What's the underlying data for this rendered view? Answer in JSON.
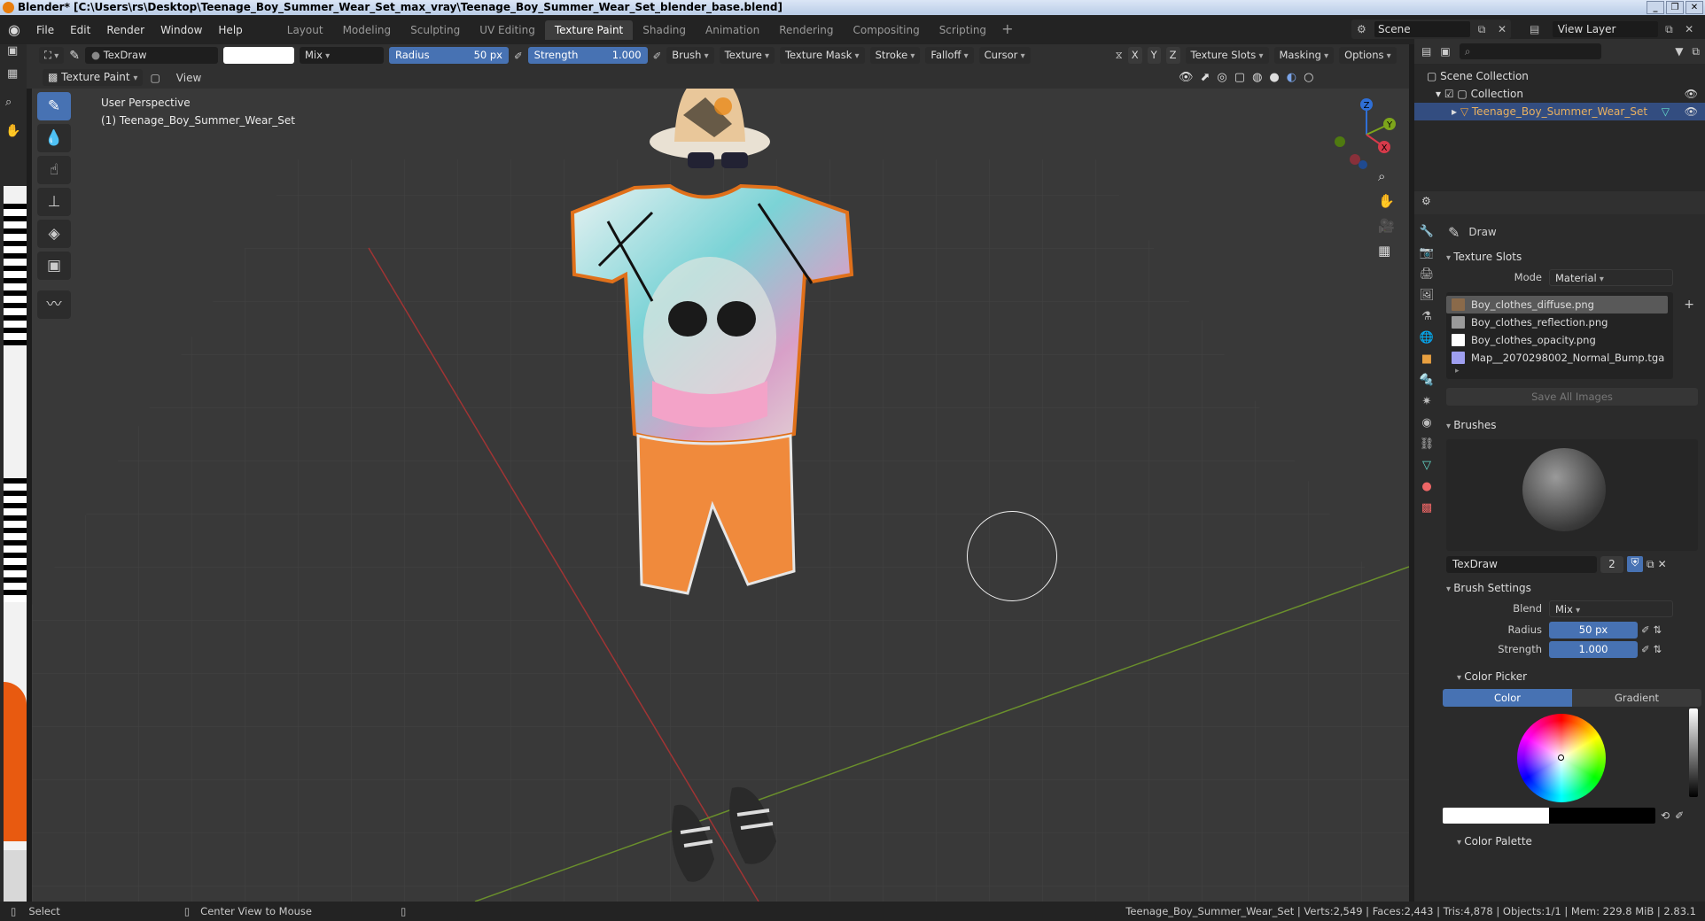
{
  "window": {
    "title": "Blender* [C:\\Users\\rs\\Desktop\\Teenage_Boy_Summer_Wear_Set_max_vray\\Teenage_Boy_Summer_Wear_Set_blender_base.blend]",
    "controls": [
      "_",
      "❐",
      "✕"
    ]
  },
  "menu": [
    "File",
    "Edit",
    "Render",
    "Window",
    "Help"
  ],
  "workspaces": [
    "Layout",
    "Modeling",
    "Sculpting",
    "UV Editing",
    "Texture Paint",
    "Shading",
    "Animation",
    "Rendering",
    "Compositing",
    "Scripting"
  ],
  "active_workspace": "Texture Paint",
  "scene": {
    "name": "Scene"
  },
  "view_layer": {
    "name": "View Layer"
  },
  "tool_settings": {
    "brush_name": "TexDraw",
    "color": "#ffffff",
    "blend": "Mix",
    "radius_label": "Radius",
    "radius_value": "50 px",
    "strength_label": "Strength",
    "strength_value": "1.000",
    "dropdowns": [
      "Brush",
      "Texture",
      "Texture Mask",
      "Stroke",
      "Falloff",
      "Cursor"
    ],
    "axes": [
      "X",
      "Y",
      "Z"
    ],
    "right_dropdowns": [
      "Texture Slots",
      "Masking",
      "Options"
    ]
  },
  "header2": {
    "mode": "Texture Paint",
    "view": "View"
  },
  "viewport": {
    "perspective": "User Perspective",
    "object": "(1) Teenage_Boy_Summer_Wear_Set"
  },
  "gizmo": {
    "x": "X",
    "y": "Y",
    "z": "Z"
  },
  "outliner": {
    "root": "Scene Collection",
    "collection": "Collection",
    "object": "Teenage_Boy_Summer_Wear_Set",
    "search_placeholder": ""
  },
  "properties": {
    "tool_name": "Draw",
    "texture_slots": {
      "title": "Texture Slots",
      "mode_label": "Mode",
      "mode_value": "Material",
      "slots": [
        {
          "name": "Boy_clothes_diffuse.png",
          "color": "#8a6a4a"
        },
        {
          "name": "Boy_clothes_reflection.png",
          "color": "#9a9a9a"
        },
        {
          "name": "Boy_clothes_opacity.png",
          "color": "#ffffff"
        },
        {
          "name": "Map__2070298002_Normal_Bump.tga",
          "color": "#9f9ff0"
        }
      ],
      "save_all": "Save All Images"
    },
    "brushes": {
      "title": "Brushes",
      "name": "TexDraw",
      "users": "2"
    },
    "brush_settings": {
      "title": "Brush Settings",
      "blend_label": "Blend",
      "blend_value": "Mix",
      "radius_label": "Radius",
      "radius_value": "50 px",
      "strength_label": "Strength",
      "strength_value": "1.000"
    },
    "color_picker": {
      "title": "Color Picker",
      "tab_color": "Color",
      "tab_gradient": "Gradient"
    },
    "color_palette": {
      "title": "Color Palette"
    }
  },
  "statusbar": {
    "select": "Select",
    "center": "Center View to Mouse",
    "stats": "Teenage_Boy_Summer_Wear_Set | Verts:2,549 | Faces:2,443 | Tris:4,878 | Objects:1/1 | Mem: 229.8 MiB | 2.83.1"
  }
}
